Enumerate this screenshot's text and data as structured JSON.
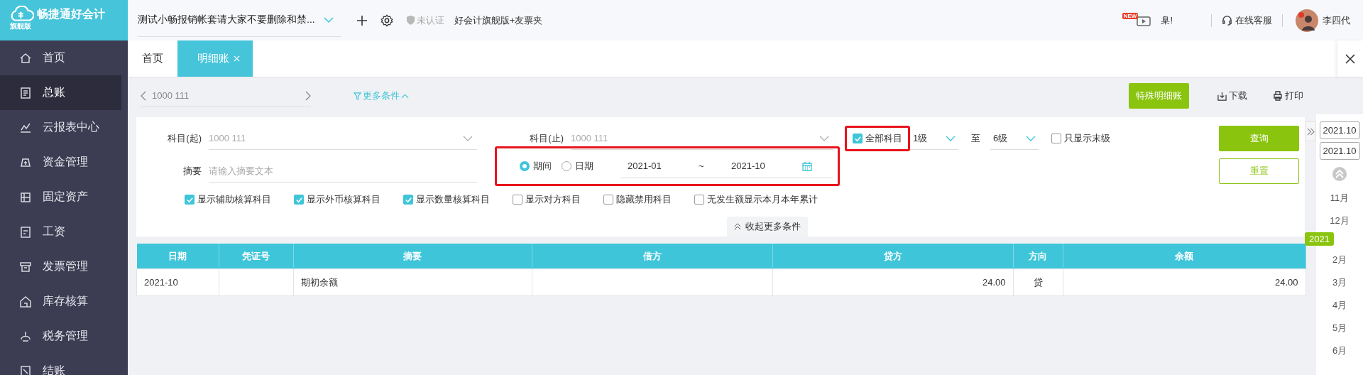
{
  "app": {
    "logo": "畅捷通好会计",
    "edition": "旗舰版"
  },
  "sidebar": {
    "items": [
      {
        "label": "首页",
        "selected": false
      },
      {
        "label": "总账",
        "selected": true
      },
      {
        "label": "云报表中心",
        "selected": false
      },
      {
        "label": "资金管理",
        "selected": false
      },
      {
        "label": "固定资产",
        "selected": false
      },
      {
        "label": "工资",
        "selected": false
      },
      {
        "label": "发票管理",
        "selected": false
      },
      {
        "label": "库存核算",
        "selected": false
      },
      {
        "label": "税务管理",
        "selected": false
      },
      {
        "label": "结账",
        "selected": false
      }
    ]
  },
  "top_bar": {
    "account": "测试小畅报销帐套请大家不要删除和禁...",
    "certification": "未认证",
    "product": "好会计旗舰版+友票夹",
    "new_badge": "NEW",
    "notice": "臬!",
    "support": "在线客服",
    "user": "李四代"
  },
  "tabs": [
    {
      "label": "首页",
      "selected": false,
      "closable": false
    },
    {
      "label": "明细账",
      "selected": true,
      "closable": true
    }
  ],
  "toolbar": {
    "account_nav": "1000 111",
    "more_filters": "更多条件",
    "buttons": [
      {
        "label": "特殊明细账",
        "kind": "primary"
      },
      {
        "label": "下载",
        "kind": "download"
      },
      {
        "label": "打印",
        "kind": "print"
      }
    ]
  },
  "filters": {
    "subject_from": {
      "label": "科目(起)",
      "value": "1000 111"
    },
    "subject_to": {
      "label": "科目(止)",
      "value": "1000 111"
    },
    "all_subjects": {
      "label": "全部科目",
      "checked": true,
      "highlighted": true
    },
    "level_from": "1级",
    "level_sep": "至",
    "level_to": "6级",
    "leaf_only": {
      "label": "只显示末级",
      "checked": false
    },
    "summary": {
      "label": "摘要",
      "placeholder": "请输入摘要文本"
    },
    "period": {
      "highlighted": true,
      "options": [
        {
          "label": "期间",
          "selected": true
        },
        {
          "label": "日期",
          "selected": false
        }
      ],
      "start": "2021-01",
      "separator": "~",
      "end": "2021-10"
    },
    "query_button": "查询",
    "reset_button": "重置",
    "options": [
      {
        "label": "显示辅助核算科目",
        "checked": true
      },
      {
        "label": "显示外币核算科目",
        "checked": true
      },
      {
        "label": "显示数量核算科目",
        "checked": true
      },
      {
        "label": "显示对方科目",
        "checked": false
      },
      {
        "label": "隐藏禁用科目",
        "checked": false
      },
      {
        "label": "无发生额显示本月本年累计",
        "checked": false
      }
    ],
    "collapse": "收起更多条件"
  },
  "table": {
    "columns": [
      "日期",
      "凭证号",
      "摘要",
      "借方",
      "贷方",
      "方向",
      "余额"
    ],
    "rows": [
      [
        "2021-10",
        "",
        "期初余额",
        "",
        "24.00",
        "贷",
        "24.00"
      ]
    ]
  },
  "timeline": {
    "ranges": [
      "2021.10",
      "2021.10"
    ],
    "items": [
      {
        "label": "11月",
        "kind": "month"
      },
      {
        "label": "12月",
        "kind": "month"
      },
      {
        "label": "2021",
        "kind": "year"
      },
      {
        "label": "2月",
        "kind": "month"
      },
      {
        "label": "3月",
        "kind": "month"
      },
      {
        "label": "4月",
        "kind": "month"
      },
      {
        "label": "5月",
        "kind": "month"
      },
      {
        "label": "6月",
        "kind": "month"
      }
    ]
  }
}
